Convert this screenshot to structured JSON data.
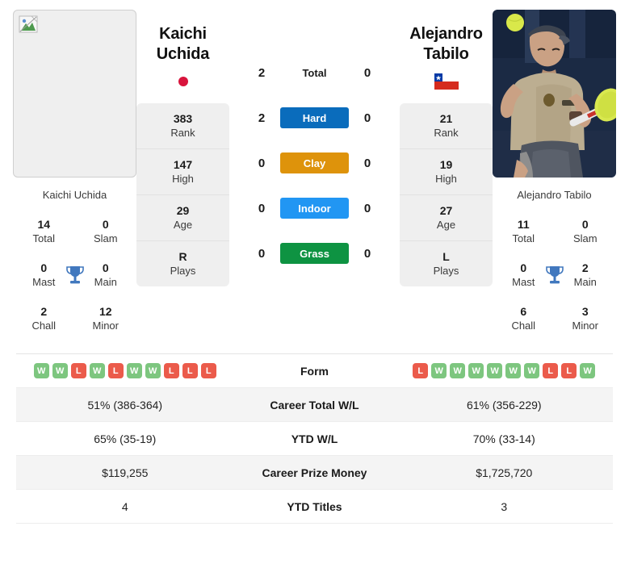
{
  "players": {
    "left": {
      "name_line1": "Kaichi",
      "name_line2": "Uchida",
      "full_name": "Kaichi Uchida",
      "photo_caption": "Kaichi Uchida",
      "flag": "japan-flag",
      "photo": "broken-image-placeholder",
      "info": [
        {
          "value": "383",
          "label": "Rank"
        },
        {
          "value": "147",
          "label": "High"
        },
        {
          "value": "29",
          "label": "Age"
        },
        {
          "value": "R",
          "label": "Plays"
        }
      ],
      "titles": [
        {
          "value": "14",
          "label": "Total"
        },
        {
          "value": "0",
          "label": "Slam"
        },
        {
          "value": "0",
          "label": "Mast"
        },
        {
          "value": "0",
          "label": "Main"
        },
        {
          "value": "2",
          "label": "Chall"
        },
        {
          "value": "12",
          "label": "Minor"
        }
      ],
      "form": [
        "W",
        "W",
        "L",
        "W",
        "L",
        "W",
        "W",
        "L",
        "L",
        "L"
      ],
      "career_total_wl": "51% (386-364)",
      "ytd_wl": "65% (35-19)",
      "career_prize_money": "$119,255",
      "ytd_titles": "4"
    },
    "right": {
      "name_line1": "Alejandro",
      "name_line2": "Tabilo",
      "full_name": "Alejandro Tabilo",
      "photo_caption": "Alejandro Tabilo",
      "flag": "chile-flag",
      "photo": "tennis-player-photo",
      "info": [
        {
          "value": "21",
          "label": "Rank"
        },
        {
          "value": "19",
          "label": "High"
        },
        {
          "value": "27",
          "label": "Age"
        },
        {
          "value": "L",
          "label": "Plays"
        }
      ],
      "titles": [
        {
          "value": "11",
          "label": "Total"
        },
        {
          "value": "0",
          "label": "Slam"
        },
        {
          "value": "0",
          "label": "Mast"
        },
        {
          "value": "2",
          "label": "Main"
        },
        {
          "value": "6",
          "label": "Chall"
        },
        {
          "value": "3",
          "label": "Minor"
        }
      ],
      "form": [
        "L",
        "W",
        "W",
        "W",
        "W",
        "W",
        "W",
        "L",
        "L",
        "W"
      ],
      "career_total_wl": "61% (356-229)",
      "ytd_wl": "70% (33-14)",
      "career_prize_money": "$1,725,720",
      "ytd_titles": "3"
    }
  },
  "head_to_head": [
    {
      "surface": "Total",
      "left": "2",
      "right": "0",
      "color": "transparent",
      "pill": false
    },
    {
      "surface": "Hard",
      "left": "2",
      "right": "0",
      "color": "#0a6cbc",
      "pill": true
    },
    {
      "surface": "Clay",
      "left": "0",
      "right": "0",
      "color": "#de930b",
      "pill": true
    },
    {
      "surface": "Indoor",
      "left": "0",
      "right": "0",
      "color": "#2196f3",
      "pill": true
    },
    {
      "surface": "Grass",
      "left": "0",
      "right": "0",
      "color": "#0e9342",
      "pill": true
    }
  ],
  "stats_rows": [
    {
      "label": "Form",
      "left": "",
      "right": ""
    },
    {
      "label": "Career Total W/L",
      "left": "51% (386-364)",
      "right": "61% (356-229)"
    },
    {
      "label": "YTD W/L",
      "left": "65% (35-19)",
      "right": "70% (33-14)"
    },
    {
      "label": "Career Prize Money",
      "left": "$119,255",
      "right": "$1,725,720"
    },
    {
      "label": "YTD Titles",
      "left": "4",
      "right": "3"
    }
  ],
  "colors": {
    "hard": "#0a6cbc",
    "clay": "#de930b",
    "indoor": "#2196f3",
    "grass": "#0e9342",
    "win_badge": "#7dc67f",
    "loss_badge": "#eb5b4b",
    "card_bg": "#efefef",
    "trophy": "#4178be"
  }
}
